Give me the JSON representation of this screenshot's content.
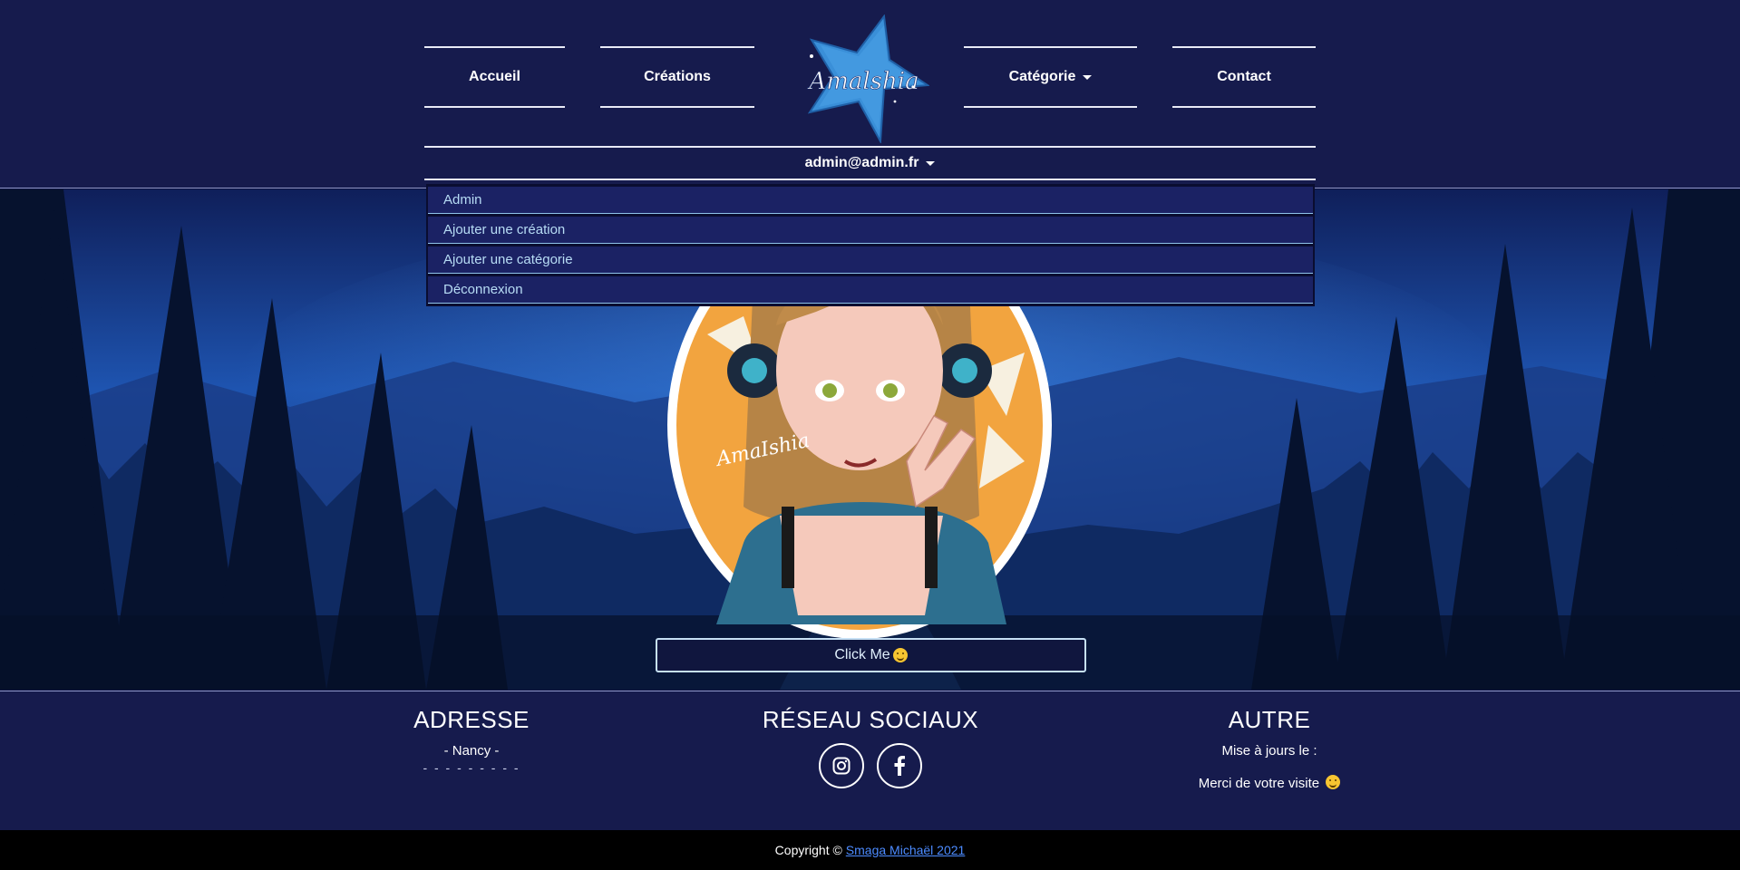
{
  "nav": {
    "home": "Accueil",
    "creations": "Créations",
    "category": "Catégorie",
    "contact": "Contact",
    "logo_text": "Amalshia"
  },
  "user": {
    "email": "admin@admin.fr"
  },
  "dropdown": {
    "items": [
      {
        "label": "Admin"
      },
      {
        "label": "Ajouter une création"
      },
      {
        "label": "Ajouter une catégorie"
      },
      {
        "label": "Déconnexion"
      }
    ]
  },
  "hero": {
    "signature": "AmaIshia",
    "cta_label": "Click Me"
  },
  "footer": {
    "address": {
      "title": "ADRESSE",
      "city": "- Nancy -",
      "dashes": "- - - - - - - - -"
    },
    "social": {
      "title": "RÉSEAU SOCIAUX",
      "icons": [
        "instagram-icon",
        "facebook-icon"
      ]
    },
    "other": {
      "title": "AUTRE",
      "updated": "Mise à jours le :",
      "thanks": "Merci de votre visite"
    }
  },
  "copyright": {
    "prefix": "Copyright ©",
    "link": "Smaga Michaël 2021"
  },
  "colors": {
    "header_bg": "#161b4d",
    "dropdown_item_bg": "#1b2264",
    "dropdown_text": "#b7dcf5",
    "accent_orange": "#f2a43f",
    "logo_blue": "#3a8fd8",
    "link_blue": "#4c8bff"
  }
}
